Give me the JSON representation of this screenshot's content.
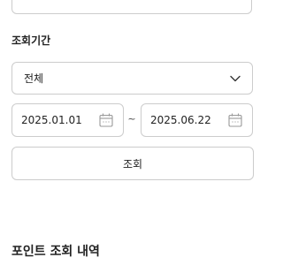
{
  "period_filter": {
    "label": "조회기간",
    "select_value": "전체",
    "start_date": "2025.01.01",
    "separator": "~",
    "end_date": "2025.06.22",
    "search_button_label": "조회"
  },
  "history": {
    "title": "포인트 조회 내역"
  },
  "icons": {
    "dropdown": "chevron-down-icon",
    "date": "calendar-icon"
  }
}
